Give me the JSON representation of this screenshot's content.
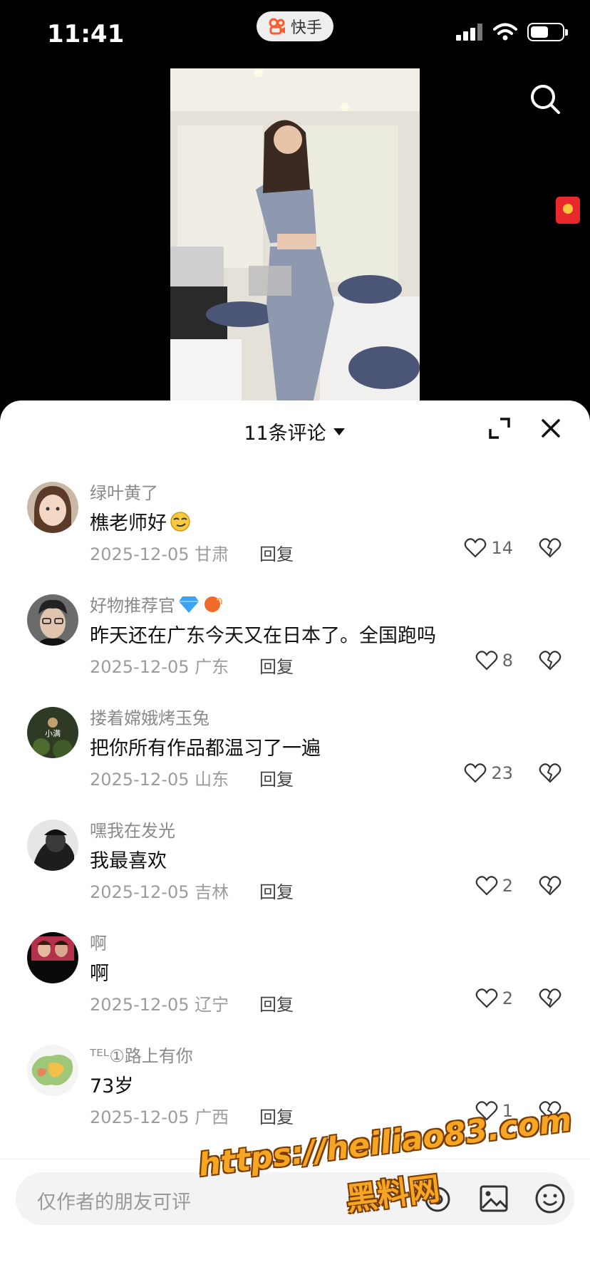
{
  "status_bar": {
    "time": "11:41",
    "app_label": "快手"
  },
  "sheet": {
    "title": "11条评论"
  },
  "comments": [
    {
      "username": "绿叶黄了",
      "text": "樵老师好",
      "emoji": "smirk-face",
      "date": "2025-12-05",
      "region": "甘肃",
      "reply_label": "回复",
      "likes": "14"
    },
    {
      "username": "好物推荐官",
      "badges": [
        "diamond-icon",
        "fire-icon"
      ],
      "text": "昨天还在广东今天又在日本了。全国跑吗",
      "date": "2025-12-05",
      "region": "广东",
      "reply_label": "回复",
      "likes": "8"
    },
    {
      "username": "搂着嫦娥烤玉兔",
      "avatar_text": "小满",
      "text": "把你所有作品都温习了一遍",
      "date": "2025-12-05",
      "region": "山东",
      "reply_label": "回复",
      "likes": "23"
    },
    {
      "username": "嘿我在发光",
      "text": "我最喜欢",
      "date": "2025-12-05",
      "region": "吉林",
      "reply_label": "回复",
      "likes": "2"
    },
    {
      "username": "啊",
      "text": "啊",
      "date": "2025-12-05",
      "region": "辽宁",
      "reply_label": "回复",
      "likes": "2"
    },
    {
      "username": "ᵀᴱᴸ①路上有你",
      "text": "73岁",
      "date": "2025-12-05",
      "region": "广西",
      "reply_label": "回复",
      "likes": "1"
    }
  ],
  "input": {
    "placeholder": "仅作者的朋友可评"
  },
  "watermark": {
    "url": "https://heiliao83.com",
    "name": "黑料网"
  },
  "colors": {
    "accent_red": "#e8282b",
    "watermark": "#f5a623"
  }
}
